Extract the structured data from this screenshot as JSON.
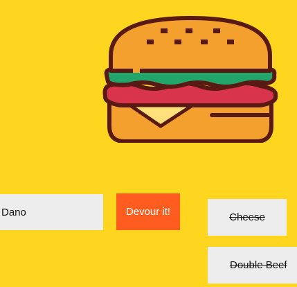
{
  "burger_form": {
    "name_value": "Dano",
    "devour_label": "Devour it!"
  },
  "devoured": {
    "items": [
      {
        "name": "Cheese"
      },
      {
        "name": "Double Beef"
      }
    ]
  },
  "colors": {
    "background": "#fed61f",
    "button": "#fe5d1f",
    "input_bg": "#ededed",
    "bun": "#f4a02f",
    "outline": "#5a1a14",
    "lettuce": "#22a56a",
    "patty": "#d8344c",
    "cheese": "#ffe07a"
  },
  "icon": "hamburger-icon"
}
